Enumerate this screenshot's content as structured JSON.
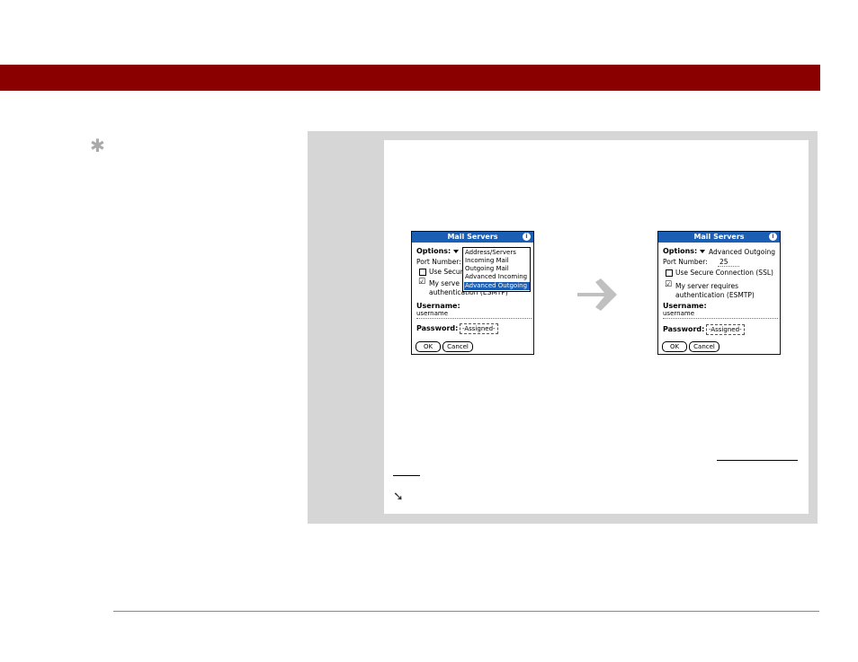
{
  "page": {
    "tip_icon": "asterisk-icon",
    "continue_icon": "arrow-down-right-icon",
    "arrow_icon": "arrow-right-icon",
    "arrow_color": "#c0c0c0",
    "banner_color": "#8a0000"
  },
  "left_screen": {
    "title": "Mail Servers",
    "info": "i",
    "options_label": "Options:",
    "port_label": "Port Number:",
    "secure_partial": "Use  Secur",
    "server_partial": "My serve",
    "server_line2": "authentication (ESMTP)",
    "username_label": "Username:",
    "username_value": "username",
    "password_label": "Password:",
    "password_value": "-Assigned-",
    "ok": "OK",
    "cancel": "Cancel",
    "dropdown": [
      "Address/Servers",
      "Incoming Mail",
      "Outgoing Mail",
      "Advanced Incoming",
      "Advanced Outgoing"
    ],
    "dropdown_selected": "Advanced Outgoing"
  },
  "right_screen": {
    "title": "Mail Servers",
    "info": "i",
    "options_label": "Options:",
    "options_value": "Advanced Outgoing",
    "port_label": "Port Number:",
    "port_value": "25",
    "secure_label": "Use  Secure Connection (SSL)",
    "server_line1": "My server requires",
    "server_line2": "authentication (ESMTP)",
    "username_label": "Username:",
    "username_value": "username",
    "password_label": "Password:",
    "password_value": "-Assigned-",
    "ok": "OK",
    "cancel": "Cancel"
  }
}
